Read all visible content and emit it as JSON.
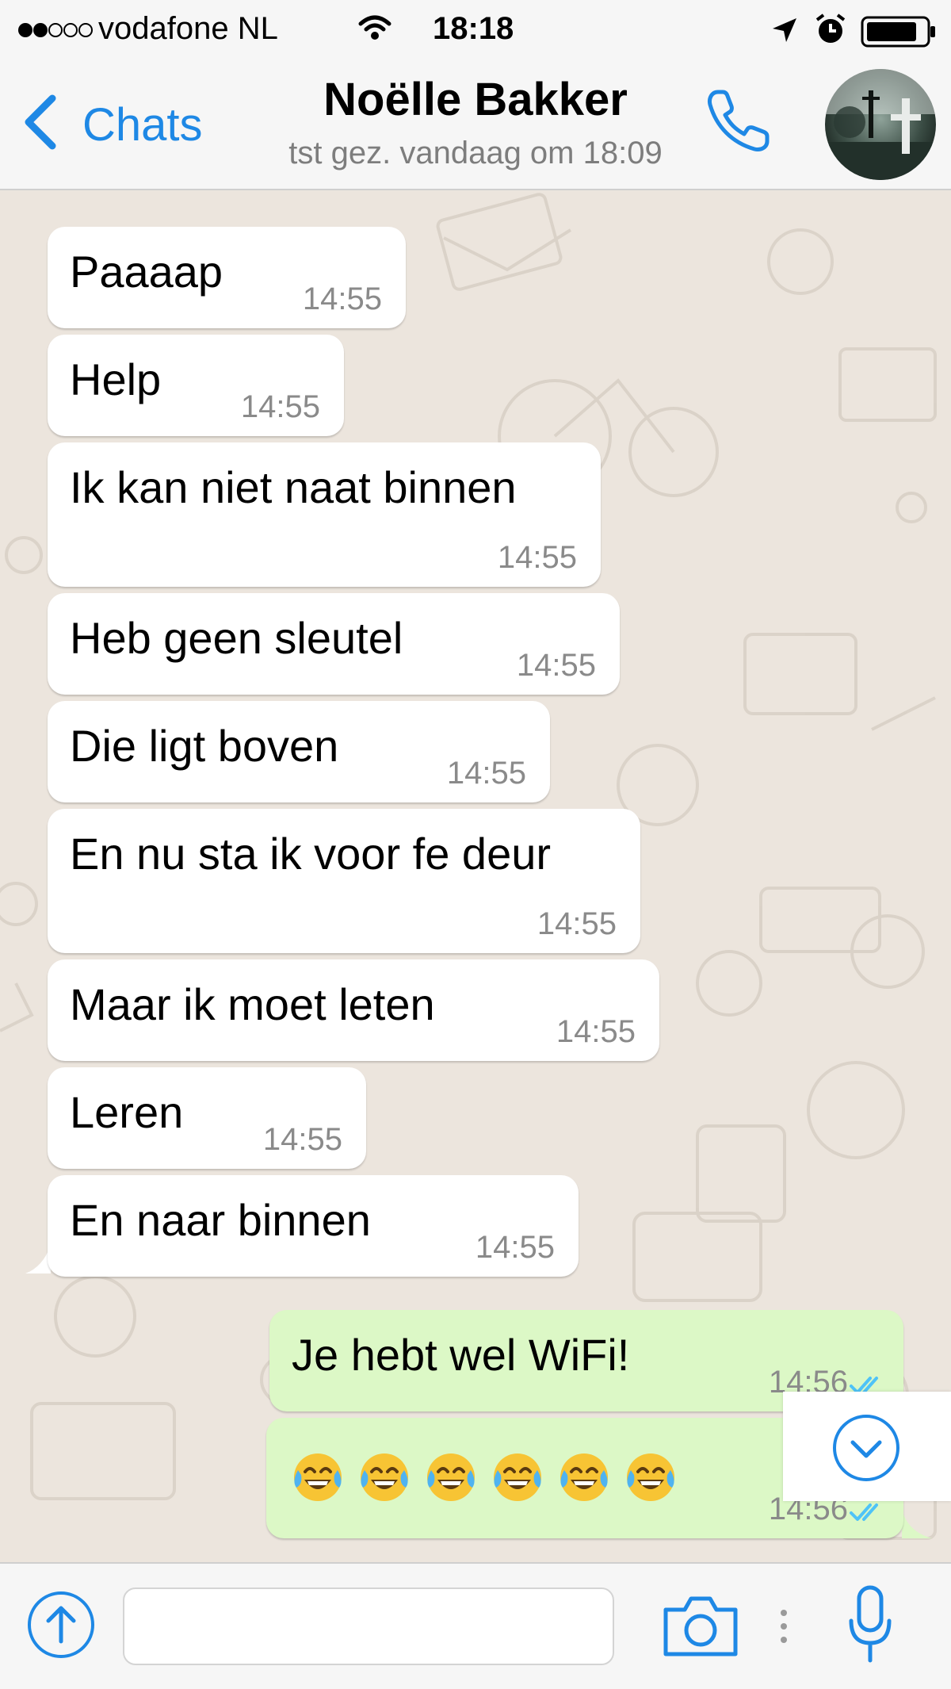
{
  "status_bar": {
    "carrier": "vodafone NL",
    "time": "18:18",
    "signal_bars_filled": 2,
    "signal_bars_total": 5
  },
  "header": {
    "back_label": "Chats",
    "contact_name": "Noëlle Bakker",
    "last_seen": "tst gez. vandaag om 18:09"
  },
  "messages": [
    {
      "direction": "incoming",
      "text": "Paaaap",
      "time": "14:55"
    },
    {
      "direction": "incoming",
      "text": "Help",
      "time": "14:55"
    },
    {
      "direction": "incoming",
      "text": "Ik kan niet naat binnen",
      "time": "14:55"
    },
    {
      "direction": "incoming",
      "text": "Heb geen sleutel",
      "time": "14:55"
    },
    {
      "direction": "incoming",
      "text": "Die ligt boven",
      "time": "14:55"
    },
    {
      "direction": "incoming",
      "text": "En nu sta ik voor fe deur",
      "time": "14:55"
    },
    {
      "direction": "incoming",
      "text": "Maar ik moet leten",
      "time": "14:55"
    },
    {
      "direction": "incoming",
      "text": "Leren",
      "time": "14:55"
    },
    {
      "direction": "incoming",
      "text": "En naar binnen",
      "time": "14:55"
    },
    {
      "direction": "outgoing",
      "text": "Je hebt wel WiFi!",
      "time": "14:56",
      "status": "read"
    },
    {
      "direction": "outgoing",
      "text": "😂😂😂😂😂😂",
      "time": "14:56",
      "status": "read",
      "emoji_count": 6
    }
  ],
  "icons": {
    "back": "chevron-left-icon",
    "call": "phone-icon",
    "attach": "share-arrow-up-icon",
    "camera": "camera-icon",
    "mic": "microphone-icon",
    "scroll_down": "chevron-down-circle-icon",
    "location": "location-arrow-icon",
    "alarm": "alarm-clock-icon",
    "wifi": "wifi-icon",
    "battery": "battery-icon"
  },
  "colors": {
    "accent": "#1e88e5",
    "incoming_bubble": "#ffffff",
    "outgoing_bubble": "#dcf8c6",
    "chat_background": "#ece5dd",
    "read_ticks": "#4fc3f7",
    "timestamp": "#8a8a8a"
  }
}
